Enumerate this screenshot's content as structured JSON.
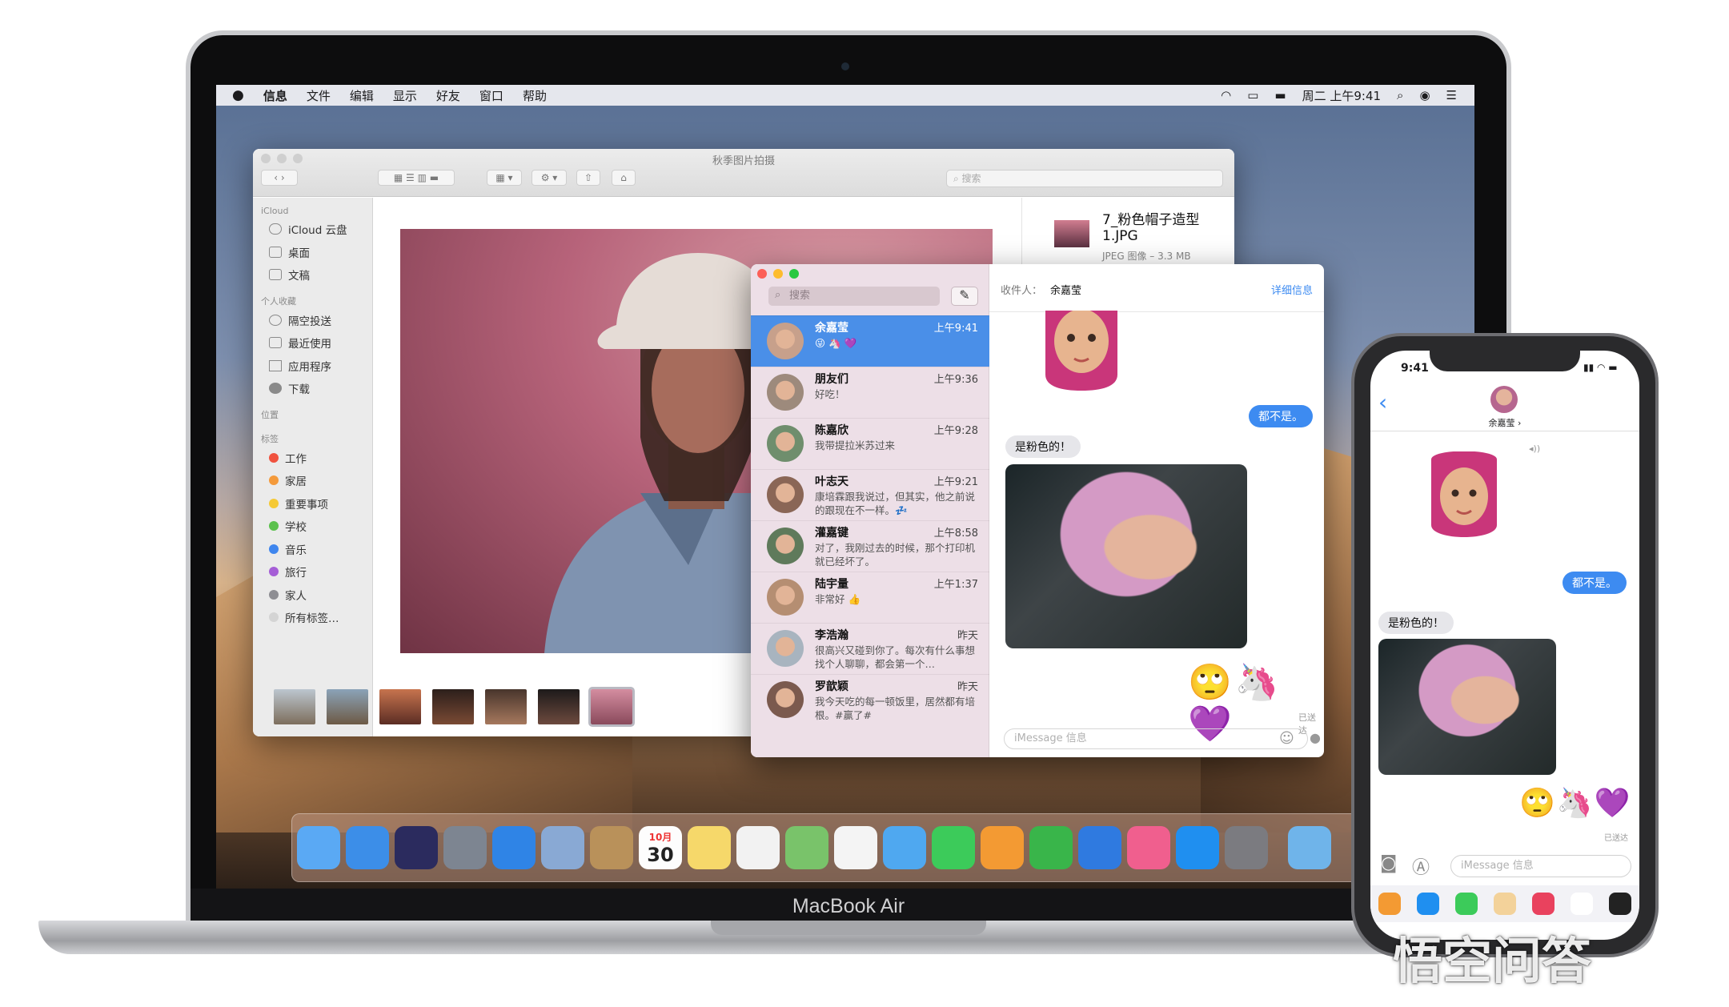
{
  "device": {
    "label": "MacBook Air"
  },
  "menubar": {
    "apple_icon": "apple-icon",
    "items": [
      "信息",
      "文件",
      "编辑",
      "显示",
      "好友",
      "窗口",
      "帮助"
    ],
    "clock": "周二 上午9:41"
  },
  "finder": {
    "title": "秋季图片拍摄",
    "search_placeholder": "搜索",
    "sidebar": {
      "icloud_header": "iCloud",
      "icloud_items": [
        "iCloud 云盘",
        "桌面",
        "文稿"
      ],
      "favorites_header": "个人收藏",
      "favorites_items": [
        "隔空投送",
        "最近使用",
        "应用程序",
        "下载"
      ],
      "locations_header": "位置",
      "tags_header": "标签",
      "tags": [
        {
          "label": "工作",
          "color": "#f0523f"
        },
        {
          "label": "家居",
          "color": "#f49a3b"
        },
        {
          "label": "重要事项",
          "color": "#f5c935"
        },
        {
          "label": "学校",
          "color": "#5bc14d"
        },
        {
          "label": "音乐",
          "color": "#3f86ee"
        },
        {
          "label": "旅行",
          "color": "#a55ed6"
        },
        {
          "label": "家人",
          "color": "#8e8e93"
        },
        {
          "label": "所有标签…",
          "color": "#d4d4d4"
        }
      ]
    },
    "info": {
      "filename": "7_粉色帽子造型 1.JPG",
      "meta": "JPEG 图像 – 3.3 MB"
    }
  },
  "messages_mac": {
    "search_placeholder": "搜索",
    "to_label": "收件人：",
    "to_name": "余嘉莹",
    "details_link": "详细信息",
    "conversations": [
      {
        "name": "余嘉莹",
        "time": "上午9:41",
        "preview": "😜 🦄 💜",
        "selected": true
      },
      {
        "name": "朋友们",
        "time": "上午9:36",
        "preview": "好吃！"
      },
      {
        "name": "陈嘉欣",
        "time": "上午9:28",
        "preview": "我带提拉米苏过来"
      },
      {
        "name": "叶志天",
        "time": "上午9:21",
        "preview": "康培霖跟我说过，但其实，他之前说的跟现在不一样。💤"
      },
      {
        "name": "灌嘉键",
        "time": "上午8:58",
        "preview": "对了，我刚过去的时候，那个打印机就已经坏了。"
      },
      {
        "name": "陆宇量",
        "time": "上午1:37",
        "preview": "非常好 👍"
      },
      {
        "name": "李浩瀚",
        "time": "昨天",
        "preview": "很高兴又碰到你了。每次有什么事想找个人聊聊，都会第一个…"
      },
      {
        "name": "罗歆颖",
        "time": "昨天",
        "preview": "我今天吃的每一顿饭里，居然都有培根。#赢了#"
      }
    ],
    "bubble_sent": "都不是。",
    "bubble_received": "是粉色的！",
    "emojis": "🙄🦄💜",
    "delivered": "已送达",
    "input_placeholder": "iMessage 信息"
  },
  "dock": {
    "apps": [
      {
        "name": "messages-app",
        "color": "#5aa9f4"
      },
      {
        "name": "finder-app",
        "color": "#3c8ee8"
      },
      {
        "name": "siri-app",
        "color": "#2b2b5e"
      },
      {
        "name": "launchpad-app",
        "color": "#7d8591"
      },
      {
        "name": "safari-app",
        "color": "#2f84e6"
      },
      {
        "name": "mail-app",
        "color": "#89a9d4"
      },
      {
        "name": "contacts-app",
        "color": "#b9915a"
      },
      {
        "name": "calendar-app",
        "color": "#fdfdfd"
      },
      {
        "name": "notes-app",
        "color": "#f6d86a"
      },
      {
        "name": "reminders-app",
        "color": "#f2f2f2"
      },
      {
        "name": "maps-app",
        "color": "#79c36a"
      },
      {
        "name": "photos-app",
        "color": "#f4f4f4"
      },
      {
        "name": "messages-app-2",
        "color": "#4fa8f0"
      },
      {
        "name": "facetime-app",
        "color": "#3ccb5a"
      },
      {
        "name": "pages-app",
        "color": "#f39a33"
      },
      {
        "name": "numbers-app",
        "color": "#39b54a"
      },
      {
        "name": "keynote-app",
        "color": "#2f7ae0"
      },
      {
        "name": "itunes-app",
        "color": "#f05f8e"
      },
      {
        "name": "appstore-app",
        "color": "#1f8ff0"
      },
      {
        "name": "preferences-app",
        "color": "#7b7b80"
      },
      {
        "name": "downloads-folder",
        "color": "#6fb4ea"
      }
    ],
    "calendar_month": "10月",
    "calendar_day": "30"
  },
  "iphone": {
    "time": "9:41",
    "contact": "余嘉莹 ›",
    "bubble_sent": "都不是。",
    "bubble_received": "是粉色的！",
    "emojis": "🙄🦄💜",
    "delivered": "已送达",
    "input_placeholder": "iMessage 信息"
  },
  "watermark": "悟空问答",
  "colors": {
    "accent": "#3d8bf1",
    "selection": "#4a8fe8"
  }
}
